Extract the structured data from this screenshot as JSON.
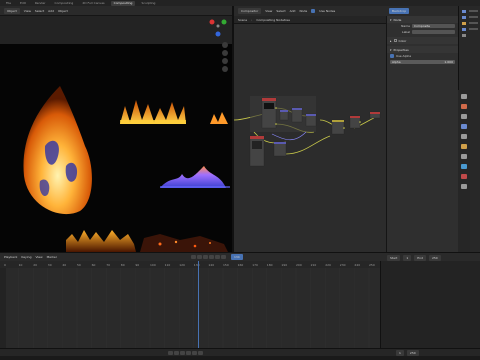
{
  "topbar": {
    "menus": [
      "File",
      "Edit",
      "Render",
      "Window",
      "Help"
    ],
    "tabs": [
      "Compositing",
      "2D Full Canvas",
      "Compositing",
      "Sculpting"
    ],
    "active_tab_index": 2
  },
  "viewport_header": {
    "mode": "Object",
    "items": [
      "View",
      "Select",
      "Add",
      "Object"
    ]
  },
  "node_header": {
    "editor": "Compositor",
    "items": [
      "View",
      "Select",
      "Add",
      "Node"
    ],
    "use_nodes_label": "Use Nodes",
    "breadcrumb": "Compositing Nodetree",
    "scene_label": "Scene"
  },
  "properties": {
    "header_label": "Backdrop",
    "panel_title": "Node",
    "name_label": "Name",
    "name_value": "Composite",
    "label_label": "Label",
    "color_label": "Color",
    "properties_label": "Properties",
    "use_alpha_label": "Use Alpha",
    "alpha_label": "Alpha",
    "alpha_value": "1.000"
  },
  "timeline": {
    "header_items": [
      "Playback",
      "Keying",
      "View",
      "Marker"
    ],
    "ticks": [
      "0",
      "10",
      "20",
      "30",
      "40",
      "50",
      "60",
      "70",
      "80",
      "90",
      "100",
      "110",
      "120",
      "130",
      "140",
      "150",
      "160",
      "170",
      "180",
      "190",
      "200",
      "210",
      "220",
      "230",
      "240",
      "250"
    ],
    "current_frame": "134",
    "start_label": "Start",
    "start_value": "1",
    "end_label": "End",
    "end_value": "250"
  },
  "colors": {
    "accent": "#4772b3",
    "fire_orange": "#ff8a1a",
    "fire_yellow": "#ffd24a",
    "flame_blue": "#7a6cff"
  }
}
